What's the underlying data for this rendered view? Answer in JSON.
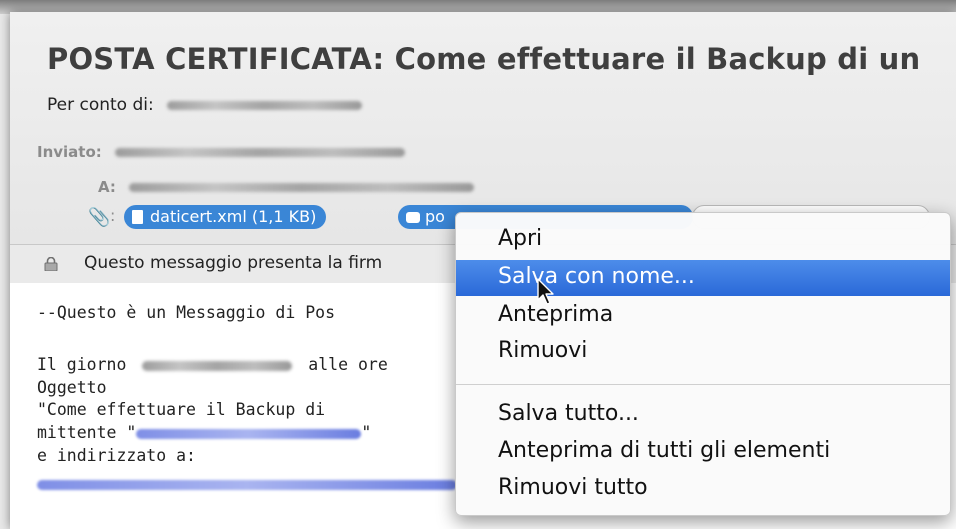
{
  "email": {
    "subject": "POSTA CERTIFICATA: Come effettuare il Backup di un",
    "per_conto_label": "Per conto di:",
    "inviato_label": "Inviato:",
    "a_label": "A:",
    "attachments": [
      {
        "label": "daticert.xml (1,1 KB)"
      },
      {
        "label": "po"
      }
    ],
    "security_text": "Questo messaggio presenta la firm",
    "body": {
      "line1": "--Questo è un Messaggio di Pos",
      "line2a": "Il giorno",
      "line2b": "alle ore",
      "line3": "Oggetto",
      "line4": "\"Come effettuare il Backup di",
      "line5a": "mittente \"",
      "line5b": "\"",
      "line6": "e indirizzato a:"
    }
  },
  "context_menu": {
    "items": [
      {
        "label": "Apri"
      },
      {
        "label": "Salva con nome..."
      },
      {
        "label": "Anteprima"
      },
      {
        "label": "Rimuovi"
      },
      {
        "label": "Salva tutto..."
      },
      {
        "label": "Anteprima di tutti gli elementi"
      },
      {
        "label": "Rimuovi tutto"
      }
    ],
    "selected_item": "Salva con nome..."
  },
  "colors": {
    "selection": "#2f6fdb",
    "attachment_pill": "#3a86d6",
    "link": "#2a4fd6"
  }
}
